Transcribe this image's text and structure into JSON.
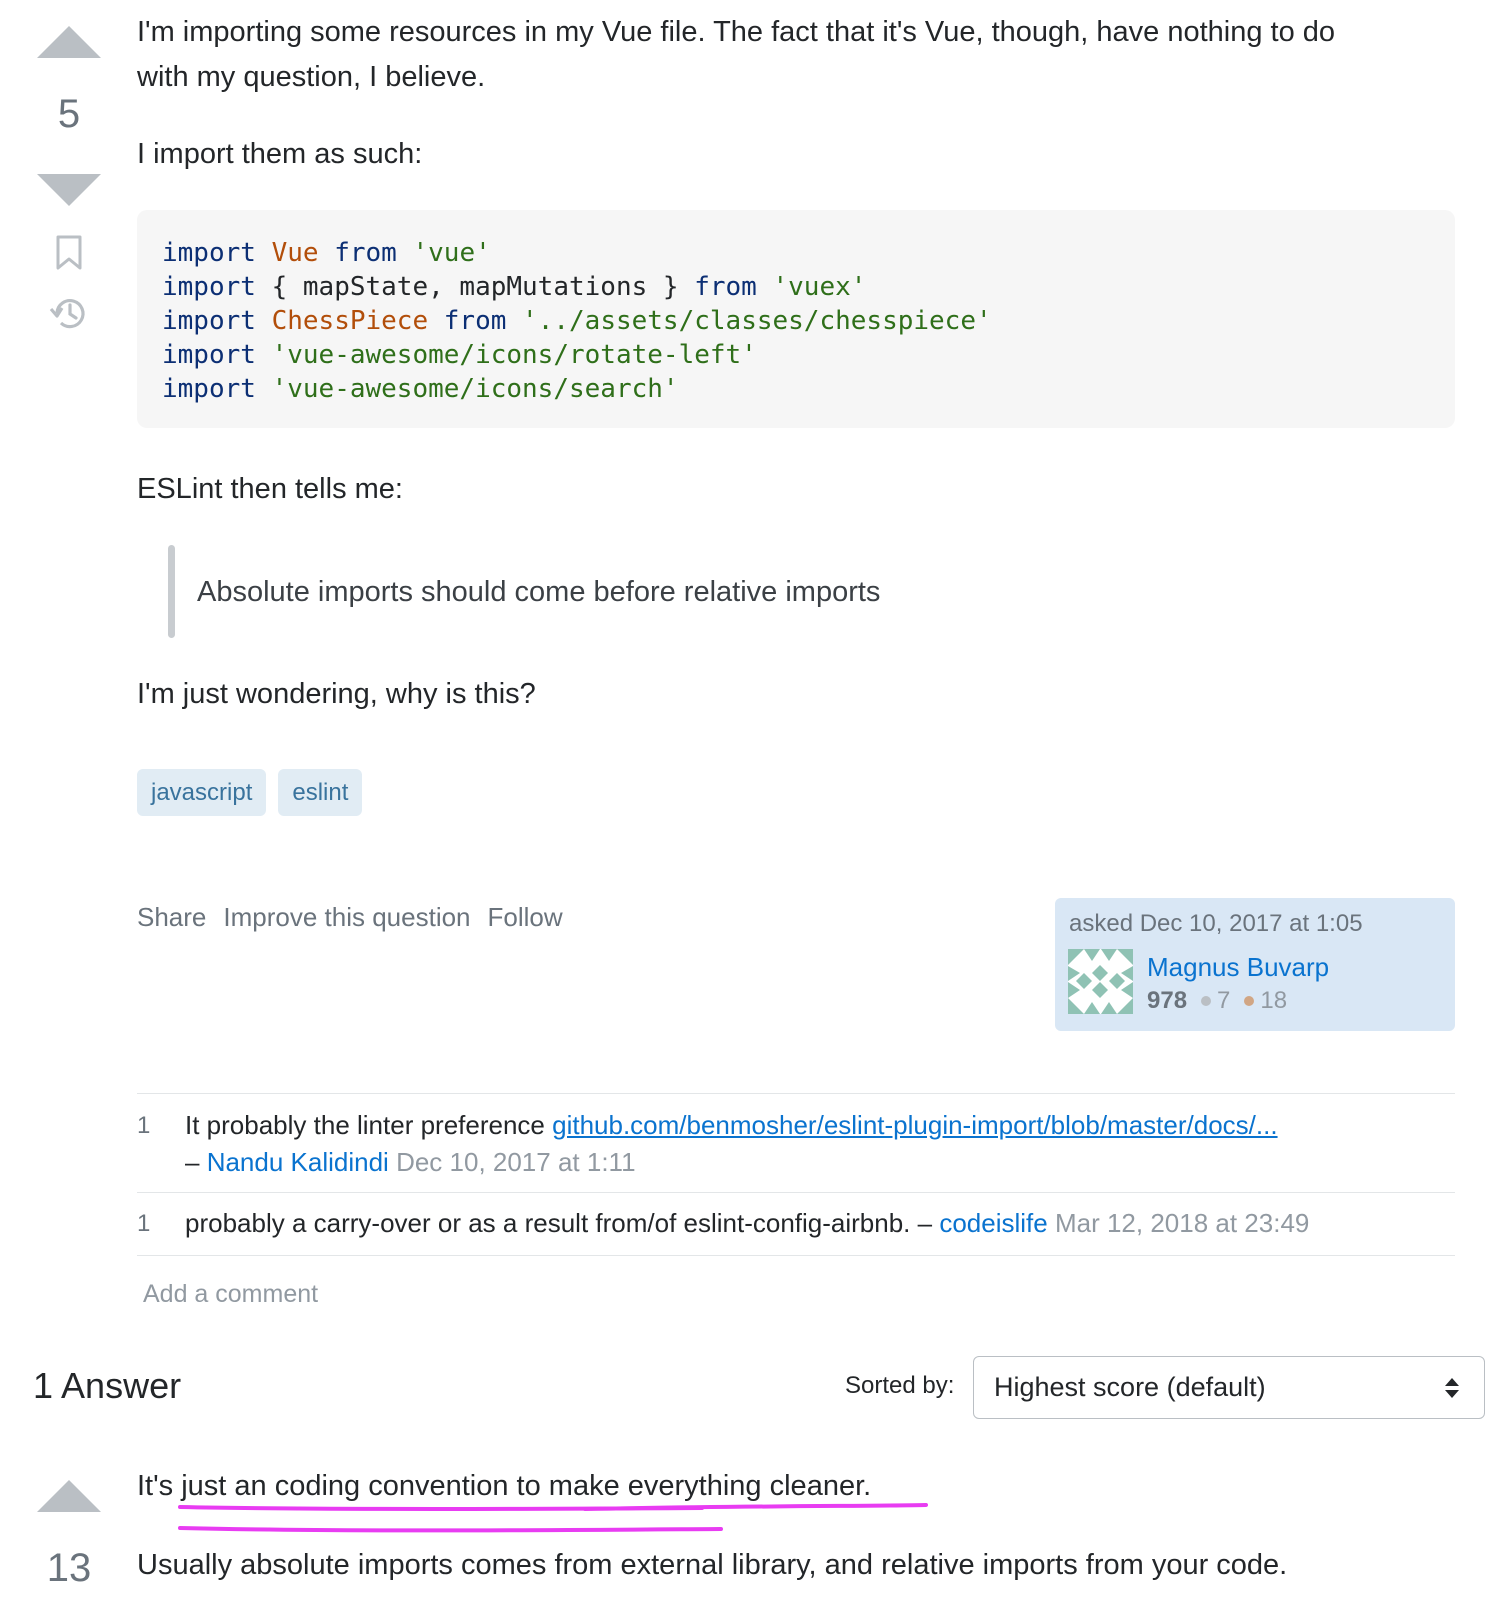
{
  "question": {
    "vote_count": "5",
    "paragraphs": {
      "intro_line1": "I'm importing some resources in my Vue file. The fact that it's Vue, though, have nothing to do",
      "intro_line2": "with my question, I believe.",
      "import_line": "I import them as such:",
      "eslint_line": "ESLint then tells me:",
      "quote": "Absolute imports should come before relative imports",
      "closing": "I'm just wondering, why is this?"
    },
    "code_lines": [
      [
        {
          "t": "kw",
          "v": "import "
        },
        {
          "t": "cls",
          "v": "Vue "
        },
        {
          "t": "kw",
          "v": "from "
        },
        {
          "t": "str",
          "v": "'vue'"
        }
      ],
      [
        {
          "t": "kw",
          "v": "import "
        },
        {
          "t": "plain",
          "v": "{ mapState, mapMutations } "
        },
        {
          "t": "kw",
          "v": "from "
        },
        {
          "t": "str",
          "v": "'vuex'"
        }
      ],
      [
        {
          "t": "kw",
          "v": "import "
        },
        {
          "t": "cls",
          "v": "ChessPiece "
        },
        {
          "t": "kw",
          "v": "from "
        },
        {
          "t": "str",
          "v": "'../assets/classes/chesspiece'"
        }
      ],
      [
        {
          "t": "kw",
          "v": "import "
        },
        {
          "t": "str",
          "v": "'vue-awesome/icons/rotate-left'"
        }
      ],
      [
        {
          "t": "kw",
          "v": "import "
        },
        {
          "t": "str",
          "v": "'vue-awesome/icons/search'"
        }
      ]
    ],
    "tags": [
      "javascript",
      "eslint"
    ],
    "actions": {
      "share": "Share",
      "improve": "Improve this question",
      "follow": "Follow"
    },
    "asker": {
      "asked_label": "asked Dec 10, 2017 at 1:05",
      "name": "Magnus Buvarp",
      "reputation": "978",
      "silver": "7",
      "bronze": "18"
    },
    "comments": [
      {
        "score": "1",
        "text": "It probably the linter preference ",
        "link": "github.com/benmosher/eslint-plugin-import/blob/master/docs/...",
        "dash": "– ",
        "user": "Nandu Kalidindi",
        "date": "Dec 10, 2017 at 1:11"
      },
      {
        "score": "1",
        "text": "probably a carry-over or as a result from/of eslint-config-airbnb. – ",
        "user": "codeislife",
        "date": "Mar 12, 2018 at 23:49"
      }
    ],
    "add_comment": "Add a comment"
  },
  "answers_header": {
    "count_label": "1 Answer",
    "sorted_by": "Sorted by:",
    "sort_value": "Highest score (default)"
  },
  "answer": {
    "vote_count": "13",
    "line1": "It's just an coding convention to make everything cleaner.",
    "line2": "Usually absolute imports comes from external library, and relative imports from your code."
  },
  "colors": {
    "highlight": "#e83cf2",
    "tag_bg": "#e1ecf4",
    "link_blue": "#0a73cf"
  }
}
